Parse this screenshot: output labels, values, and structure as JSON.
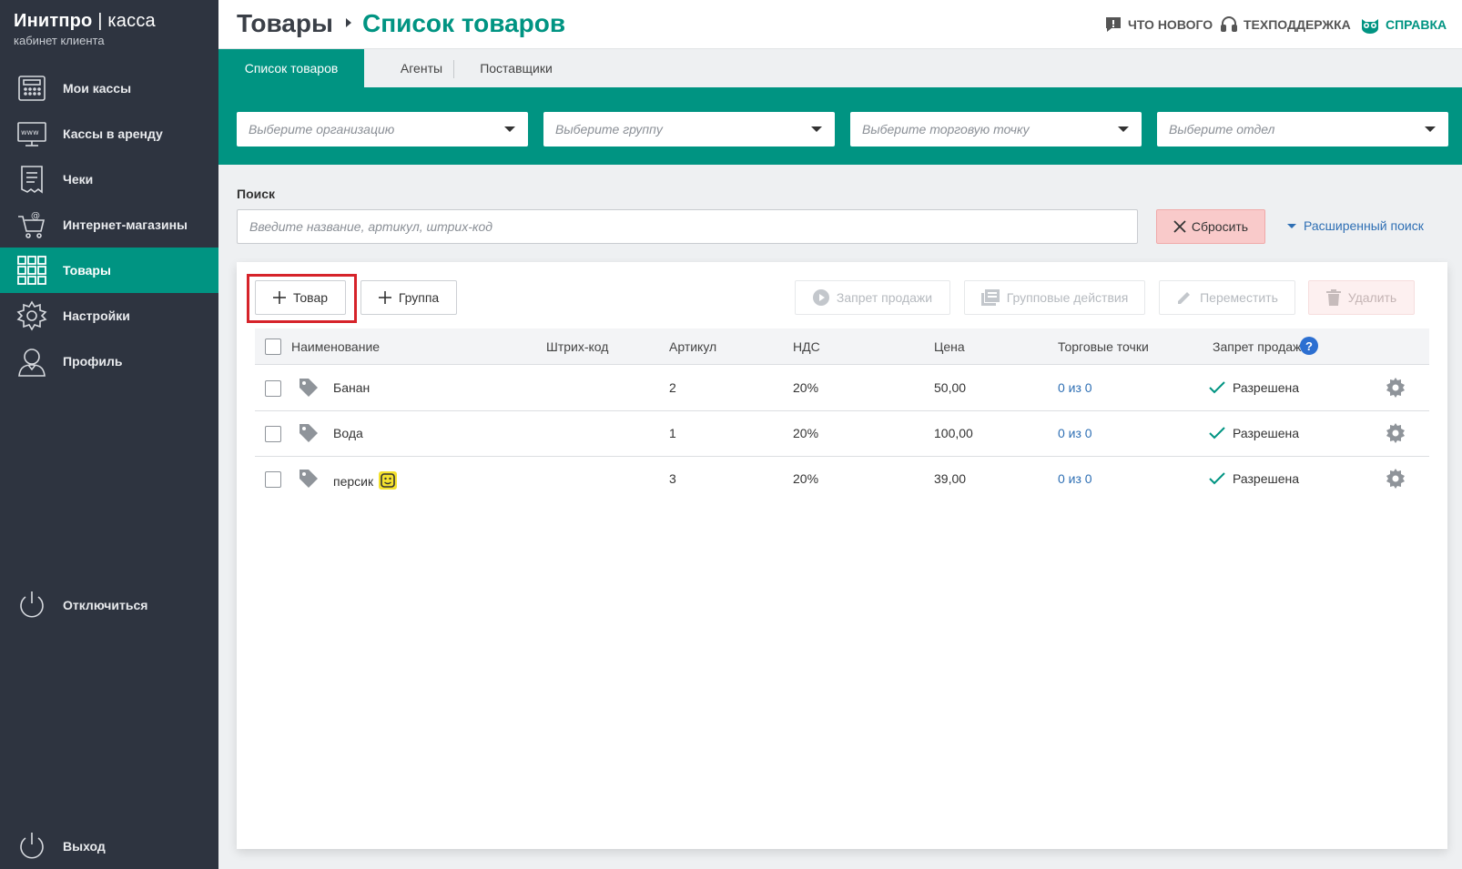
{
  "brand": {
    "name_bold": "Инитпро",
    "separator": "|",
    "name_thin": "касса",
    "subtitle": "кабинет клиента"
  },
  "sidebar": {
    "items": [
      {
        "label": "Мои кассы",
        "icon": "cash-register-icon"
      },
      {
        "label": "Кассы в аренду",
        "icon": "www-monitor-icon"
      },
      {
        "label": "Чеки",
        "icon": "receipt-icon"
      },
      {
        "label": "Интернет-магазины",
        "icon": "shopping-cart-icon"
      },
      {
        "label": "Товары",
        "icon": "grid-icon",
        "active": true
      },
      {
        "label": "Настройки",
        "icon": "gear-icon"
      },
      {
        "label": "Профиль",
        "icon": "user-icon"
      }
    ],
    "disconnect": "Отключиться",
    "logout": "Выход"
  },
  "header": {
    "root": "Товары",
    "current": "Список товаров",
    "links": {
      "whats_new": "ЧТО НОВОГО",
      "support": "ТЕХПОДДЕРЖКА",
      "help": "СПРАВКА"
    }
  },
  "tabs": [
    "Список товаров",
    "Агенты",
    "Поставщики"
  ],
  "filters": {
    "organization": "Выберите организацию",
    "group": "Выберите группу",
    "point": "Выберите торговую точку",
    "department": "Выберите отдел"
  },
  "search": {
    "label": "Поиск",
    "placeholder": "Введите название, артикул, штрих-код",
    "reset": "Сбросить",
    "advanced": "Расширенный поиск"
  },
  "toolbar": {
    "add_product": "Товар",
    "add_group": "Группа",
    "ban_sale": "Запрет продажи",
    "group_actions": "Групповые действия",
    "move": "Переместить",
    "delete": "Удалить"
  },
  "table": {
    "headers": {
      "name": "Наименование",
      "barcode": "Штрих-код",
      "article": "Артикул",
      "vat": "НДС",
      "price": "Цена",
      "points": "Торговые точки",
      "ban": "Запрет продажи"
    },
    "rows": [
      {
        "name": "Банан",
        "barcode": "",
        "article": "2",
        "vat": "20%",
        "price": "50,00",
        "points": "0 из 0",
        "ban": "Разрешена"
      },
      {
        "name": "Вода",
        "barcode": "",
        "article": "1",
        "vat": "20%",
        "price": "100,00",
        "points": "0 из 0",
        "ban": "Разрешена"
      },
      {
        "name": "персик",
        "barcode": "",
        "article": "3",
        "vat": "20%",
        "price": "39,00",
        "points": "0 из 0",
        "ban": "Разрешена",
        "badge": "yellow-smiley-icon"
      }
    ]
  },
  "colors": {
    "accent": "#009482",
    "sidebar": "#2e3440",
    "link": "#2e6fb4",
    "highlight": "#d6232a"
  }
}
